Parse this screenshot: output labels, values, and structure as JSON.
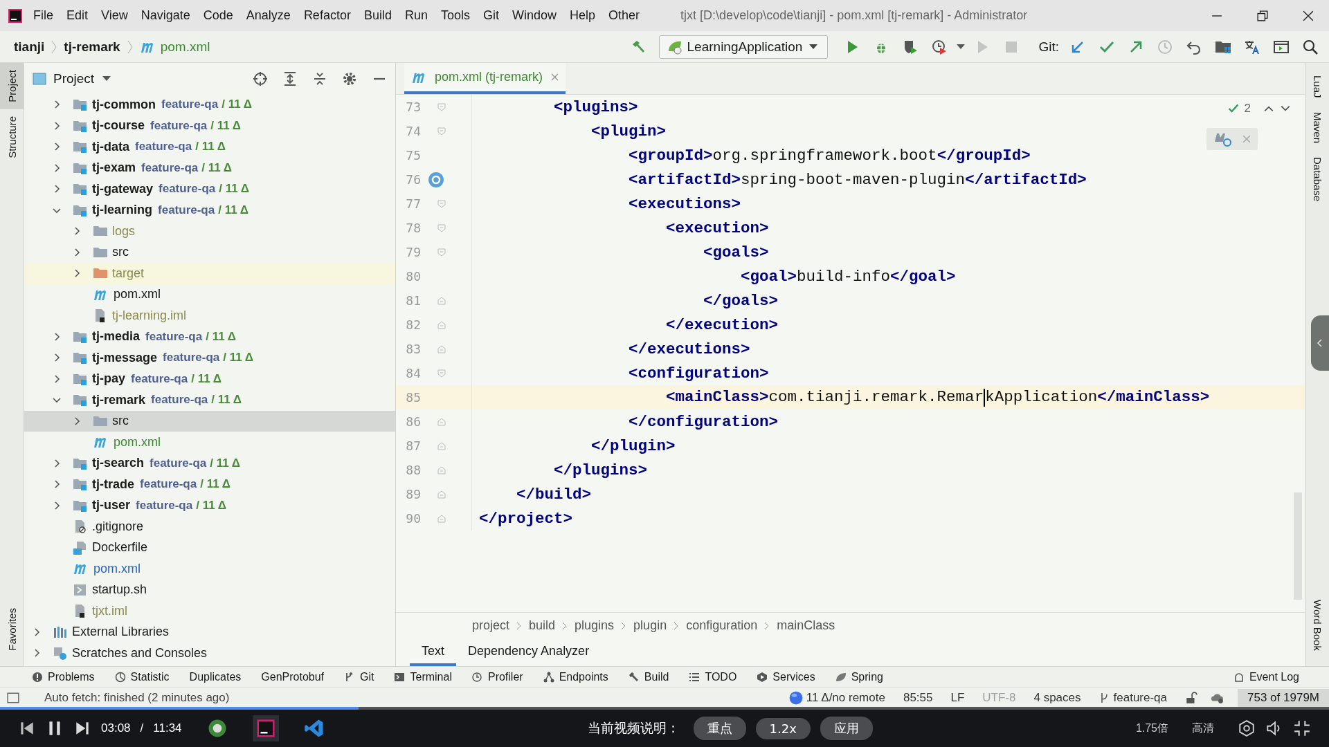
{
  "window": {
    "title": "tjxt [D:\\develop\\code\\tianji] - pom.xml [tj-remark] - Administrator"
  },
  "menu": [
    "File",
    "Edit",
    "View",
    "Navigate",
    "Code",
    "Analyze",
    "Refactor",
    "Build",
    "Run",
    "Tools",
    "Git",
    "Window",
    "Help",
    "Other"
  ],
  "navigation": {
    "crumbs": [
      "tianji",
      "tj-remark"
    ],
    "file": "pom.xml"
  },
  "toolbar": {
    "run_configuration": "LearningApplication",
    "git_label": "Git:"
  },
  "left_stripe": [
    {
      "label": "Project",
      "selected": true
    },
    {
      "label": "Structure",
      "selected": false
    },
    {
      "label": "Favorites",
      "selected": false
    }
  ],
  "right_stripe": [
    "LuaJ",
    "Maven",
    "Database",
    "Word Book"
  ],
  "project_panel": {
    "title": "Project",
    "project_children": [
      {
        "kind": "module",
        "name": "tj-common",
        "branch": "feature-qa",
        "changes": "/ 11 Δ",
        "expanded": false
      },
      {
        "kind": "module",
        "name": "tj-course",
        "branch": "feature-qa",
        "changes": "/ 11 Δ",
        "expanded": false
      },
      {
        "kind": "module",
        "name": "tj-data",
        "branch": "feature-qa",
        "changes": "/ 11 Δ",
        "expanded": false
      },
      {
        "kind": "module",
        "name": "tj-exam",
        "branch": "feature-qa",
        "changes": "/ 11 Δ",
        "expanded": false
      },
      {
        "kind": "module",
        "name": "tj-gateway",
        "branch": "feature-qa",
        "changes": "/ 11 Δ",
        "expanded": false
      },
      {
        "kind": "module",
        "name": "tj-learning",
        "branch": "feature-qa",
        "changes": "/ 11 Δ",
        "expanded": true,
        "children": [
          {
            "kind": "folder",
            "name": "logs",
            "color": "#8a8a4e",
            "expanded": false
          },
          {
            "kind": "folder",
            "name": "src",
            "color": "#1a1a1a",
            "expanded": false
          },
          {
            "kind": "excluded-folder",
            "name": "target",
            "color": "#8a8a4e",
            "expanded": false,
            "highlighted": true
          },
          {
            "kind": "maven",
            "name": "pom.xml",
            "color": "#1a1a1a"
          },
          {
            "kind": "iml",
            "name": "tj-learning.iml",
            "color": "#8a8a4e"
          }
        ]
      },
      {
        "kind": "module",
        "name": "tj-media",
        "branch": "feature-qa",
        "changes": "/ 11 Δ",
        "expanded": false
      },
      {
        "kind": "module",
        "name": "tj-message",
        "branch": "feature-qa",
        "changes": "/ 11 Δ",
        "expanded": false
      },
      {
        "kind": "module",
        "name": "tj-pay",
        "branch": "feature-qa",
        "changes": "/ 11 Δ",
        "expanded": false
      },
      {
        "kind": "module",
        "name": "tj-remark",
        "branch": "feature-qa",
        "changes": "/ 11 Δ",
        "expanded": true,
        "children": [
          {
            "kind": "folder",
            "name": "src",
            "color": "#1a1a1a",
            "expanded": false,
            "selected": true
          },
          {
            "kind": "maven",
            "name": "pom.xml",
            "color": "#3b8a2e"
          }
        ]
      },
      {
        "kind": "module",
        "name": "tj-search",
        "branch": "feature-qa",
        "changes": "/ 11 Δ",
        "expanded": false
      },
      {
        "kind": "module",
        "name": "tj-trade",
        "branch": "feature-qa",
        "changes": "/ 11 Δ",
        "expanded": false
      },
      {
        "kind": "module",
        "name": "tj-user",
        "branch": "feature-qa",
        "changes": "/ 11 Δ",
        "expanded": false
      },
      {
        "kind": "gitignore",
        "name": ".gitignore",
        "color": "#1a1a1a"
      },
      {
        "kind": "docker",
        "name": "Dockerfile",
        "color": "#1a1a1a"
      },
      {
        "kind": "maven",
        "name": "pom.xml",
        "color": "#2a62b8"
      },
      {
        "kind": "shell",
        "name": "startup.sh",
        "color": "#1a1a1a"
      },
      {
        "kind": "iml",
        "name": "tjxt.iml",
        "color": "#8a8a4e"
      }
    ],
    "top_level": [
      {
        "kind": "libraries",
        "name": "External Libraries",
        "expanded": false
      },
      {
        "kind": "scratches",
        "name": "Scratches and Consoles",
        "expanded": false
      }
    ]
  },
  "editor": {
    "tab": {
      "label": "pom.xml (tj-remark)",
      "selected": true
    },
    "inspection_count": "2",
    "lines": [
      {
        "number": "73",
        "kind": "fold-start",
        "parts": [
          {
            "kind": "tag",
            "text": "        <plugins>"
          }
        ]
      },
      {
        "number": "74",
        "kind": "fold-start",
        "parts": [
          {
            "kind": "tag",
            "text": "            <plugin>"
          }
        ]
      },
      {
        "number": "75",
        "kind": "plain",
        "parts": [
          {
            "kind": "tag",
            "text": "                <groupId>"
          },
          {
            "kind": "text",
            "text": "org.springframework.boot"
          },
          {
            "kind": "tag",
            "text": "</groupId>"
          }
        ]
      },
      {
        "number": "76",
        "kind": "spring",
        "parts": [
          {
            "kind": "tag",
            "text": "                <artifactId>"
          },
          {
            "kind": "text",
            "text": "spring-boot-maven-plugin"
          },
          {
            "kind": "tag",
            "text": "</artifactId>"
          }
        ]
      },
      {
        "number": "77",
        "kind": "fold-start",
        "parts": [
          {
            "kind": "tag",
            "text": "                <executions>"
          }
        ]
      },
      {
        "number": "78",
        "kind": "fold-start",
        "parts": [
          {
            "kind": "tag",
            "text": "                    <execution>"
          }
        ]
      },
      {
        "number": "79",
        "kind": "fold-start",
        "parts": [
          {
            "kind": "tag",
            "text": "                        <goals>"
          }
        ]
      },
      {
        "number": "80",
        "kind": "plain",
        "parts": [
          {
            "kind": "tag",
            "text": "                            <goal>"
          },
          {
            "kind": "text",
            "text": "build-info"
          },
          {
            "kind": "tag",
            "text": "</goal>"
          }
        ]
      },
      {
        "number": "81",
        "kind": "fold-end",
        "parts": [
          {
            "kind": "tag",
            "text": "                        </goals>"
          }
        ]
      },
      {
        "number": "82",
        "kind": "fold-end",
        "parts": [
          {
            "kind": "tag",
            "text": "                    </execution>"
          }
        ]
      },
      {
        "number": "83",
        "kind": "fold-end",
        "parts": [
          {
            "kind": "tag",
            "text": "                </executions>"
          }
        ]
      },
      {
        "number": "84",
        "kind": "fold-start",
        "parts": [
          {
            "kind": "tag",
            "text": "                <configuration>"
          }
        ]
      },
      {
        "number": "85",
        "kind": "plain",
        "current": true,
        "parts": [
          {
            "kind": "tag",
            "text": "                    <mainClass>"
          },
          {
            "kind": "text",
            "text": "com.tianji.remark.Remar"
          },
          {
            "kind": "caret"
          },
          {
            "kind": "text",
            "text": "kApplication"
          },
          {
            "kind": "tag",
            "text": "</mainClass>"
          }
        ]
      },
      {
        "number": "86",
        "kind": "fold-end",
        "parts": [
          {
            "kind": "tag",
            "text": "                </configuration>"
          }
        ]
      },
      {
        "number": "87",
        "kind": "fold-end",
        "parts": [
          {
            "kind": "tag",
            "text": "            </plugin>"
          }
        ]
      },
      {
        "number": "88",
        "kind": "fold-end",
        "parts": [
          {
            "kind": "tag",
            "text": "        </plugins>"
          }
        ]
      },
      {
        "number": "89",
        "kind": "fold-end",
        "parts": [
          {
            "kind": "tag",
            "text": "    </build>"
          }
        ]
      },
      {
        "number": "90",
        "kind": "fold-end",
        "parts": [
          {
            "kind": "tag",
            "text": "</project>"
          }
        ]
      }
    ],
    "breadcrumbs": [
      "project",
      "build",
      "plugins",
      "plugin",
      "configuration",
      "mainClass"
    ],
    "bottom_tabs": [
      {
        "label": "Text",
        "selected": true
      },
      {
        "label": "Dependency Analyzer",
        "selected": false
      }
    ]
  },
  "tool_windows": [
    "Problems",
    "Statistic",
    "Duplicates",
    "GenProtobuf",
    "Git",
    "Terminal",
    "Profiler",
    "Endpoints",
    "Build",
    "TODO",
    "Services",
    "Spring"
  ],
  "event_log": "Event Log",
  "status_bar": {
    "message": "Auto fetch: finished (2 minutes ago)",
    "vcs": "11 Δ/no remote",
    "position": "85:55",
    "line_separator": "LF",
    "encoding": "UTF-8",
    "indent": "4 spaces",
    "branch": "feature-qa",
    "memory": "753 of 1979M"
  },
  "player": {
    "level": 0.27,
    "current_time": "03:08",
    "separator": "/",
    "total_time": "11:34",
    "description_label": "当前视频说明：",
    "buttons": [
      "重点",
      "1.2x",
      "应用"
    ],
    "speed": "1.75倍",
    "quality": "高清"
  }
}
